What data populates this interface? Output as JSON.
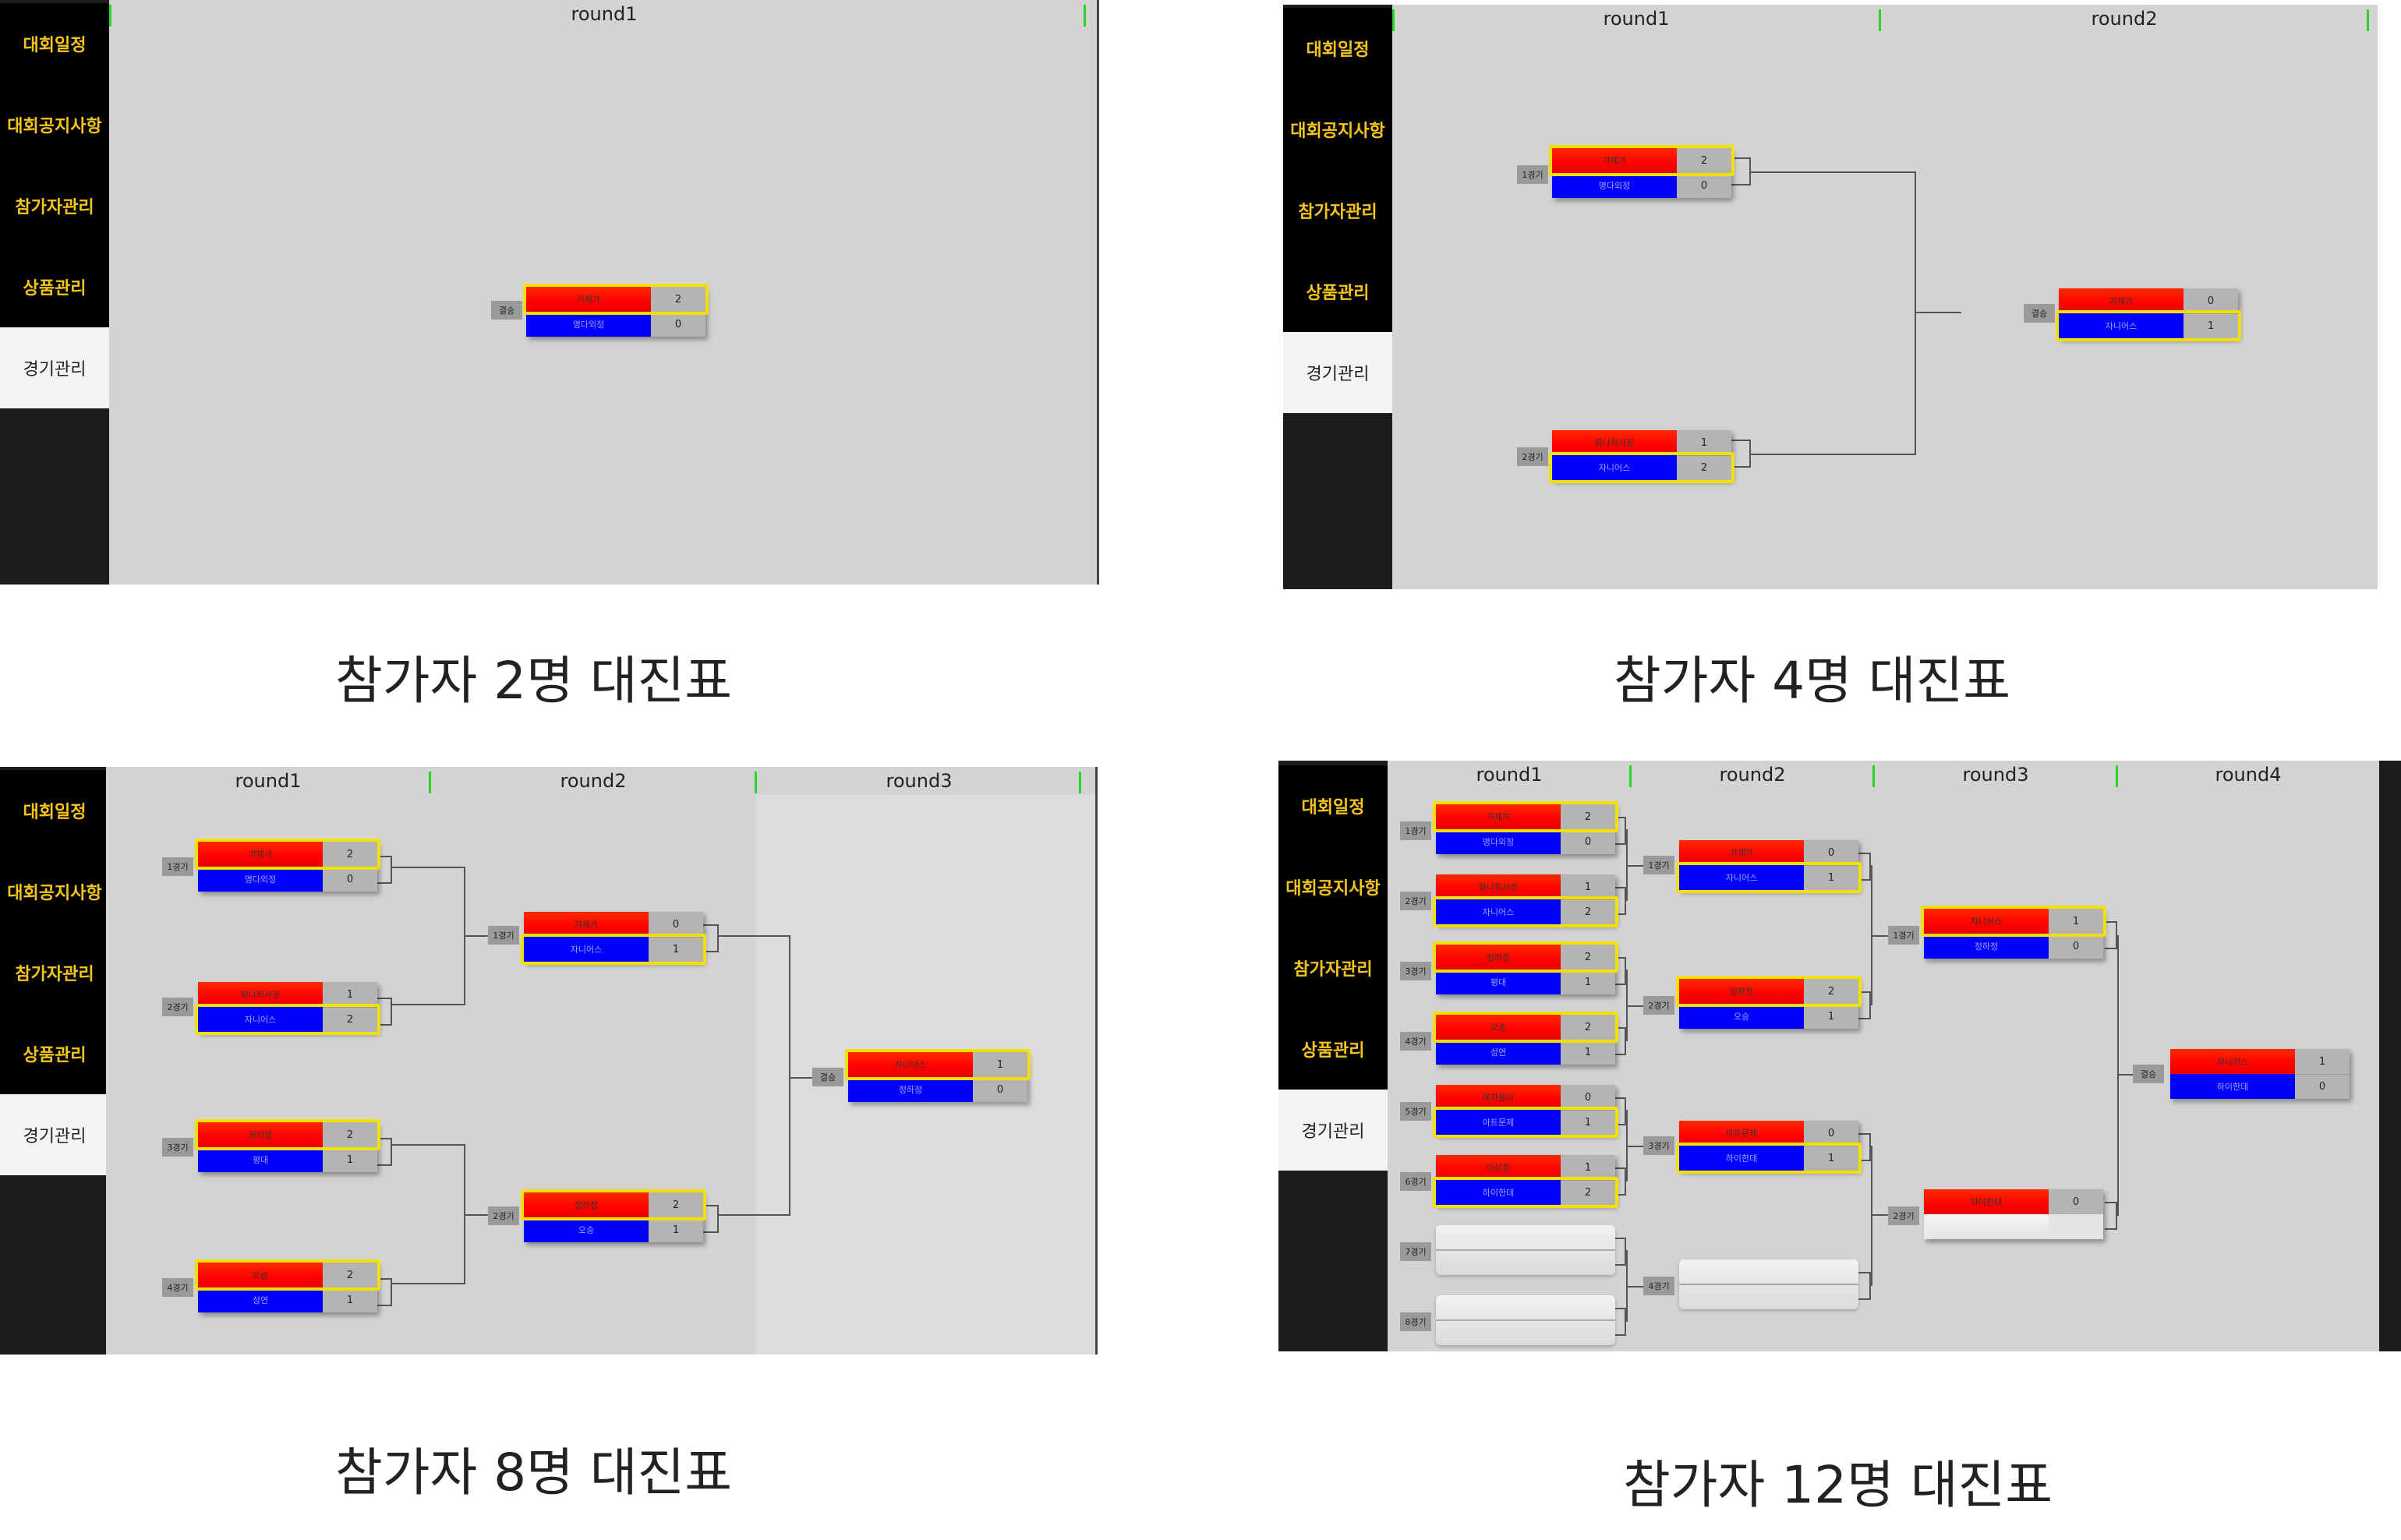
{
  "sidebar": {
    "items": [
      {
        "label": "대회일정"
      },
      {
        "label": "대회공지사항"
      },
      {
        "label": "참가자관리"
      },
      {
        "label": "상품관리"
      },
      {
        "label": "경기관리"
      }
    ]
  },
  "panels": [
    {
      "caption": "참가자 2명 대진표",
      "rounds": [
        "round1"
      ],
      "matches": [
        {
          "label": "결승",
          "team1": "가제가",
          "team2": "명다외정",
          "score1": "2",
          "score2": "0"
        }
      ]
    },
    {
      "caption": "참가자 4명 대진표",
      "rounds": [
        "round1",
        "round2"
      ],
      "matches": [
        {
          "label": "1경기",
          "team1": "가제가",
          "team2": "명다외정",
          "score1": "2",
          "score2": "0"
        },
        {
          "label": "2경기",
          "team1": "화나픽사장",
          "team2": "자니어스",
          "score1": "1",
          "score2": "2"
        },
        {
          "label": "결승",
          "team1": "가제가",
          "team2": "자니어스",
          "score1": "0",
          "score2": "1"
        }
      ]
    },
    {
      "caption": "참가자 8명 대진표",
      "rounds": [
        "round1",
        "round2",
        "round3"
      ],
      "matches": [
        {
          "label": "1경기",
          "team1": "가제가",
          "team2": "명다외정",
          "score1": "2",
          "score2": "0"
        },
        {
          "label": "2경기",
          "team1": "화나픽사장",
          "team2": "자니어스",
          "score1": "1",
          "score2": "2"
        },
        {
          "label": "3경기",
          "team1": "정하정",
          "team2": "평대",
          "score1": "2",
          "score2": "1"
        },
        {
          "label": "4경기",
          "team1": "오승",
          "team2": "성연",
          "score1": "2",
          "score2": "1"
        },
        {
          "label": "1경기",
          "team1": "가제가",
          "team2": "자니어스",
          "score1": "0",
          "score2": "1"
        },
        {
          "label": "2경기",
          "team1": "정하정",
          "team2": "오승",
          "score1": "2",
          "score2": "1"
        },
        {
          "label": "결승",
          "team1": "자니어스",
          "team2": "정하정",
          "score1": "1",
          "score2": "0"
        }
      ]
    },
    {
      "caption": "참가자 12명 대진표",
      "rounds": [
        "round1",
        "round2",
        "round3",
        "round4"
      ],
      "matches": [
        {
          "label": "1경기",
          "team1": "가제가",
          "team2": "명다외정",
          "score1": "2",
          "score2": "0"
        },
        {
          "label": "2경기",
          "team1": "화나픽사장",
          "team2": "자니어스",
          "score1": "1",
          "score2": "2"
        },
        {
          "label": "3경기",
          "team1": "정하정",
          "team2": "평대",
          "score1": "2",
          "score2": "1"
        },
        {
          "label": "4경기",
          "team1": "오승",
          "team2": "성연",
          "score1": "2",
          "score2": "1"
        },
        {
          "label": "5경기",
          "team1": "에자용아",
          "team2": "아트문제",
          "score1": "0",
          "score2": "1"
        },
        {
          "label": "6경기",
          "team1": "이상장",
          "team2": "하이한데",
          "score1": "1",
          "score2": "2"
        },
        {
          "label": "7경기",
          "team1": "",
          "team2": "",
          "score1": "",
          "score2": ""
        },
        {
          "label": "8경기",
          "team1": "",
          "team2": "",
          "score1": "",
          "score2": ""
        },
        {
          "label": "1경기",
          "team1": "가제가",
          "team2": "자니어스",
          "score1": "0",
          "score2": "1"
        },
        {
          "label": "2경기",
          "team1": "정하정",
          "team2": "오승",
          "score1": "2",
          "score2": "1"
        },
        {
          "label": "3경기",
          "team1": "아트문제",
          "team2": "하이한데",
          "score1": "0",
          "score2": "1"
        },
        {
          "label": "4경기",
          "team1": "",
          "team2": "",
          "score1": "",
          "score2": ""
        },
        {
          "label": "1경기",
          "team1": "자니어스",
          "team2": "정하정",
          "score1": "1",
          "score2": "0"
        },
        {
          "label": "2경기",
          "team1": "하이한데",
          "team2": "",
          "score1": "0",
          "score2": ""
        },
        {
          "label": "결승",
          "team1": "자니어스",
          "team2": "하이한데",
          "score1": "1",
          "score2": "0"
        }
      ]
    }
  ]
}
